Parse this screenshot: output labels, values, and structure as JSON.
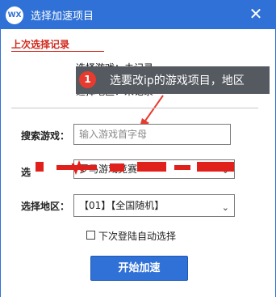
{
  "window": {
    "logo_text": "WX",
    "title": "选择加速项目",
    "close_glyph": "✕"
  },
  "last_record": {
    "section_title": "上次选择记录",
    "game_line": "选择游戏：未记录",
    "region_line": "选择地区：未记录"
  },
  "tooltip": {
    "badge": "1",
    "text": "选要改ip的游戏项目，地区"
  },
  "search": {
    "label": "搜索游戏：",
    "placeholder": "输入游戏首字母"
  },
  "game_select": {
    "label": "选",
    "value": "罗马游戏竞赛"
  },
  "region_select": {
    "label": "选择地区：",
    "value": "【01】【全国随机】"
  },
  "auto_select": {
    "label": "下次登陆自动选择",
    "checked": false
  },
  "start_button": {
    "label": "开始加速"
  },
  "colors": {
    "titlebar": "#2f71d6",
    "accent_red": "#d12a1f",
    "tooltip_bg": "#555a60",
    "badge": "#e83b2f",
    "button": "#2f71d6"
  }
}
